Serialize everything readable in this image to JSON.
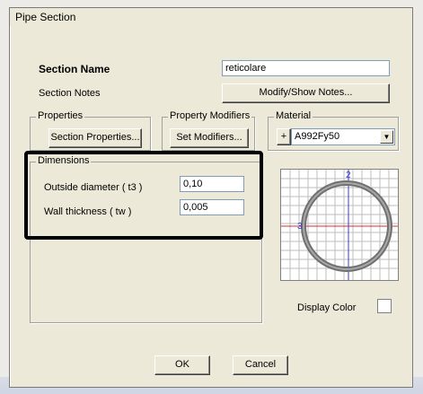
{
  "window": {
    "title": "Pipe Section"
  },
  "section": {
    "name_label": "Section Name",
    "name_value": "reticolare",
    "notes_label": "Section Notes",
    "notes_button": "Modify/Show Notes..."
  },
  "properties": {
    "group_title": "Properties",
    "button": "Section Properties..."
  },
  "modifiers": {
    "group_title": "Property Modifiers",
    "button": "Set Modifiers..."
  },
  "material": {
    "group_title": "Material",
    "plus_button": "+",
    "selected": "A992Fy50"
  },
  "dimensions": {
    "group_title": "Dimensions",
    "outside_diameter_label": "Outside diameter  ( t3 )",
    "outside_diameter_value": "0,10",
    "wall_thickness_label": "Wall thickness  ( tw )",
    "wall_thickness_value": "0,005"
  },
  "preview": {
    "axis_2": "2",
    "axis_3": "3",
    "axis_color_2": "#3a3ad0",
    "axis_color_3": "#d03030"
  },
  "display_color": {
    "label": "Display Color"
  },
  "buttons": {
    "ok": "OK",
    "cancel": "Cancel"
  }
}
